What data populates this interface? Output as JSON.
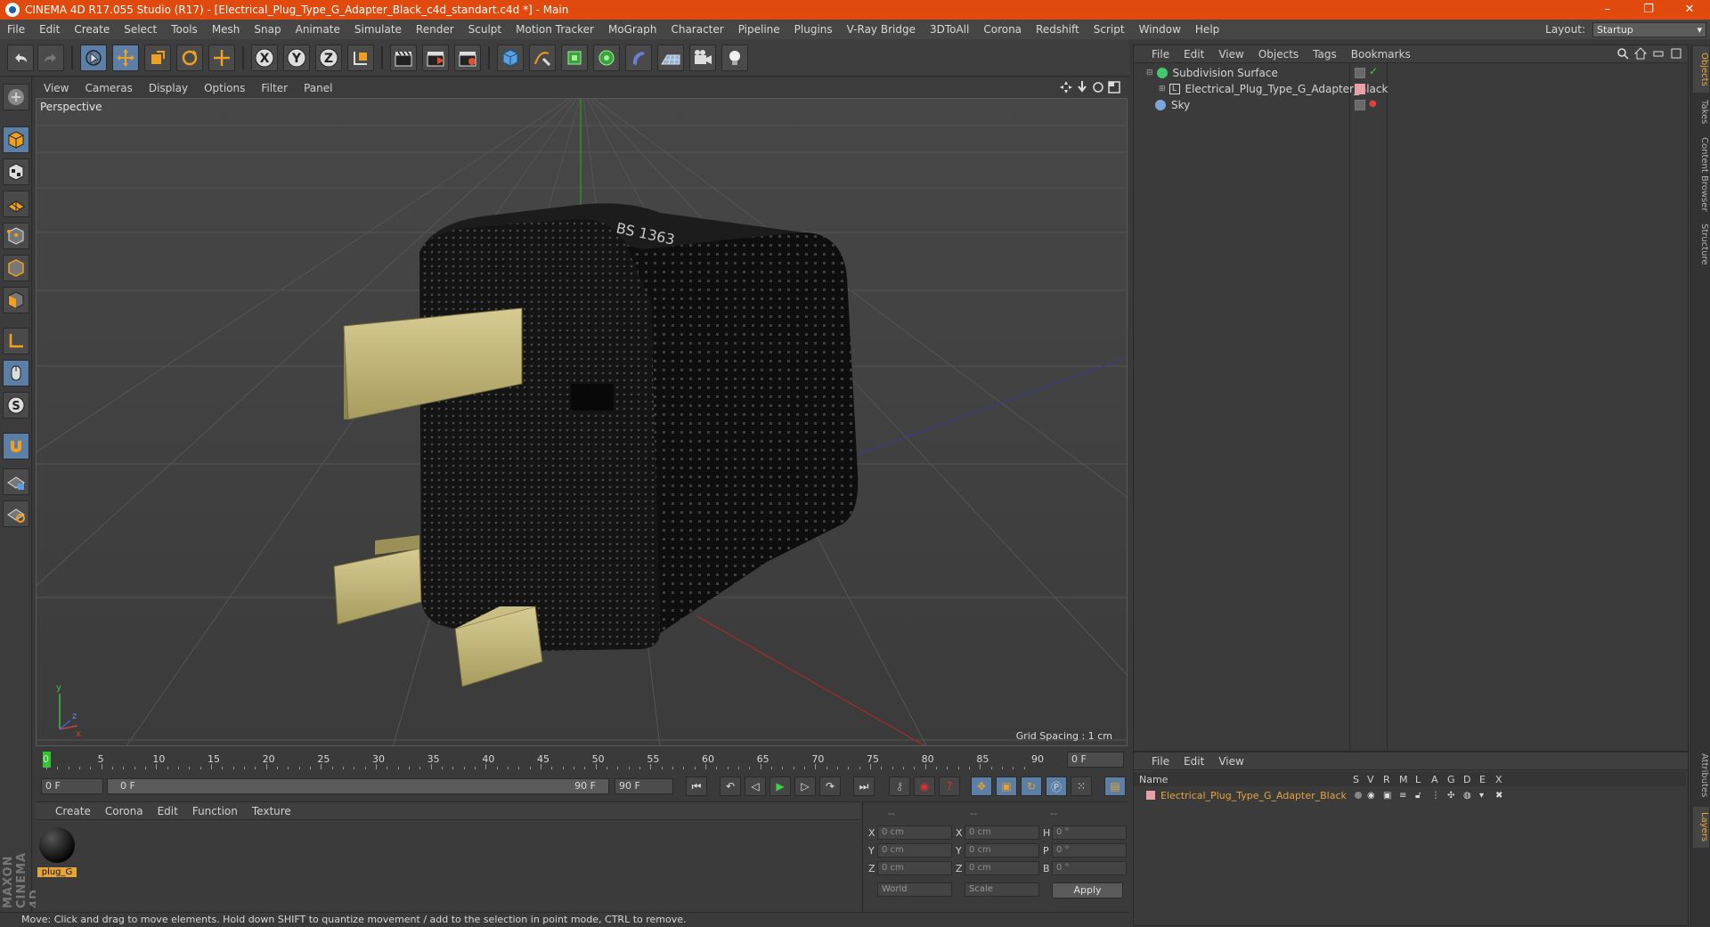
{
  "app": {
    "title": "CINEMA 4D R17.055 Studio (R17) - [Electrical_Plug_Type_G_Adapter_Black_c4d_standart.c4d *] - Main",
    "window_controls": [
      "–",
      "❐",
      "✕"
    ]
  },
  "menu": [
    "File",
    "Edit",
    "Create",
    "Select",
    "Tools",
    "Mesh",
    "Snap",
    "Animate",
    "Simulate",
    "Render",
    "Sculpt",
    "Motion Tracker",
    "MoGraph",
    "Character",
    "Pipeline",
    "Plugins",
    "V-Ray Bridge",
    "3DToAll",
    "Corona",
    "Redshift",
    "Script",
    "Window",
    "Help"
  ],
  "layout": {
    "label": "Layout:",
    "value": "Startup"
  },
  "axis_buttons": [
    "X",
    "Y",
    "Z"
  ],
  "viewport": {
    "menu": [
      "View",
      "Cameras",
      "Display",
      "Options",
      "Filter",
      "Panel"
    ],
    "label": "Perspective",
    "grid_spacing": "Grid Spacing : 1 cm",
    "plug_text": "BS 1363"
  },
  "object_manager": {
    "menu": [
      "File",
      "Edit",
      "View",
      "Objects",
      "Tags",
      "Bookmarks"
    ],
    "objects": [
      {
        "name": "Subdivision Surface",
        "color": "#42c86e"
      },
      {
        "name": "Electrical_Plug_Type_G_Adapter_Black",
        "color": "#e0e0e0"
      },
      {
        "name": "Sky",
        "color": "#7aa6d8"
      }
    ]
  },
  "right_tabs": [
    "Objects",
    "Takes",
    "Content Browser",
    "Structure",
    "Attributes",
    "Layers"
  ],
  "layers": {
    "menu": [
      "File",
      "Edit",
      "View"
    ],
    "columns": [
      "Name",
      "S",
      "V",
      "R",
      "M",
      "L",
      "A",
      "G",
      "D",
      "E",
      "X"
    ],
    "rows": [
      {
        "name": "Electrical_Plug_Type_G_Adapter_Black",
        "color": "#e8a0a8"
      }
    ]
  },
  "timeline": {
    "ticks": [
      "0",
      "5",
      "10",
      "15",
      "20",
      "25",
      "30",
      "35",
      "40",
      "45",
      "50",
      "55",
      "60",
      "65",
      "70",
      "75",
      "80",
      "85",
      "90"
    ],
    "current_frame": "0 F",
    "start": "0 F",
    "range_start": "0 F",
    "range_end": "90 F",
    "end": "90 F"
  },
  "material_manager": {
    "menu": [
      "Create",
      "Corona",
      "Edit",
      "Function",
      "Texture"
    ],
    "material": "plug_G"
  },
  "coordinates": {
    "header": [
      "--",
      "--",
      "--"
    ],
    "rows": [
      {
        "a": "X",
        "av": "0 cm",
        "b": "X",
        "bv": "0 cm",
        "c": "H",
        "cv": "0 °"
      },
      {
        "a": "Y",
        "av": "0 cm",
        "b": "Y",
        "bv": "0 cm",
        "c": "P",
        "cv": "0 °"
      },
      {
        "a": "Z",
        "av": "0 cm",
        "b": "Z",
        "bv": "0 cm",
        "c": "B",
        "cv": "0 °"
      }
    ],
    "mode1": "World",
    "mode2": "Scale",
    "apply": "Apply"
  },
  "status": "Move: Click and drag to move elements. Hold down SHIFT to quantize movement / add to the selection in point mode, CTRL to remove.",
  "brand": "MAXON CINEMA 4D"
}
